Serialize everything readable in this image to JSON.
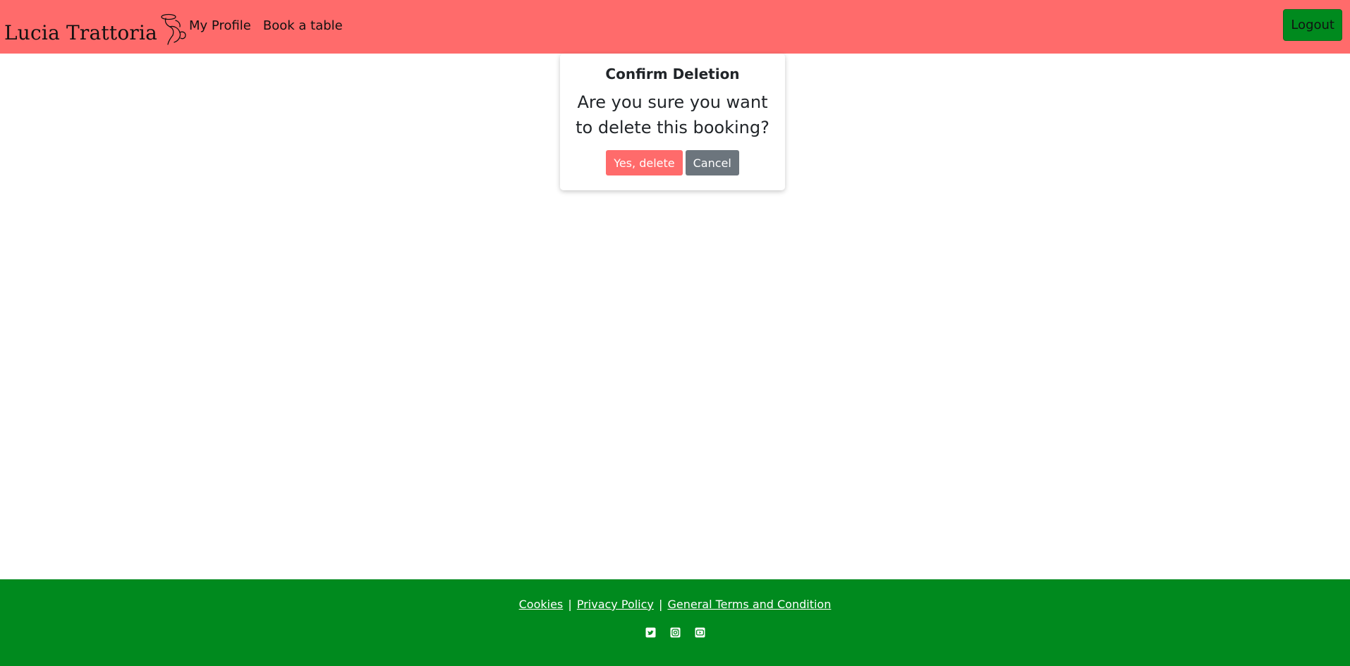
{
  "header": {
    "brand": "Lucia Trattoria",
    "nav": [
      "My Profile",
      "Book a table"
    ],
    "logout_label": "Logout"
  },
  "dialog": {
    "title": "Confirm Deletion",
    "message": "Are you sure you want to delete this booking?",
    "confirm_label": "Yes, delete",
    "cancel_label": "Cancel"
  },
  "footer": {
    "links": [
      "Cookies",
      "Privacy Policy",
      "General Terms and Condition"
    ],
    "separator": "|",
    "social_icons": [
      "twitter-icon",
      "instagram-icon",
      "youtube-icon"
    ]
  },
  "colors": {
    "header_bg": "#ff6b6b",
    "footer_bg": "#008a1e",
    "delete_button": "#ff6b6b",
    "cancel_button": "#6c757d"
  }
}
